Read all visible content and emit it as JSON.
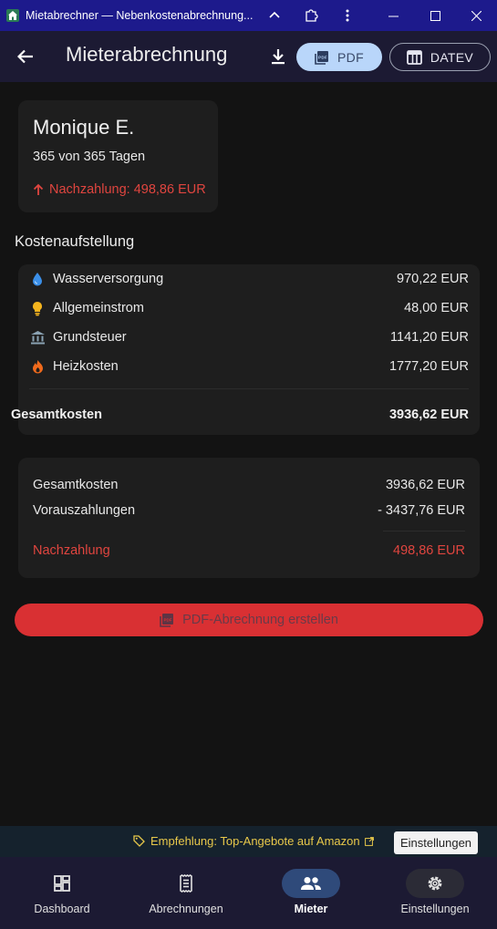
{
  "window": {
    "title": "Mietabrechner — Nebenkostenabrechnung...",
    "icons": [
      "app-home-icon",
      "pin-icon",
      "extension-icon",
      "more-icon",
      "minimize-icon",
      "maximize-icon",
      "close-icon"
    ]
  },
  "appbar": {
    "title": "Mieterabrechnung",
    "pdf_label": "PDF",
    "datev_label": "DATEV"
  },
  "tenant": {
    "name": "Monique E.",
    "days": "365 von 365 Tagen",
    "due": "Nachzahlung: 498,86 EUR"
  },
  "costs": {
    "section_title": "Kostenaufstellung",
    "items": [
      {
        "label": "Wasserversorgung",
        "value": "970,22 EUR",
        "icon": "water-drop-icon",
        "color": "#3b8fe8"
      },
      {
        "label": "Allgemeinstrom",
        "value": "48,00 EUR",
        "icon": "lightbulb-icon",
        "color": "#f5b51e"
      },
      {
        "label": "Grundsteuer",
        "value": "1141,20 EUR",
        "icon": "bank-icon",
        "color": "#8aa2b3"
      },
      {
        "label": "Heizkosten",
        "value": "1777,20 EUR",
        "icon": "flame-icon",
        "color": "#f06a1c"
      }
    ],
    "total_label": "Gesamtkosten",
    "total_value": "3936,62 EUR"
  },
  "summary": {
    "rows": [
      {
        "label": "Gesamtkosten",
        "value": "3936,62 EUR"
      },
      {
        "label": "Vorauszahlungen",
        "value": "- 3437,76 EUR"
      }
    ],
    "result_label": "Nachzahlung",
    "result_value": "498,86 EUR"
  },
  "create_button": "PDF-Abrechnung erstellen",
  "ad": {
    "text": "Empfehlung: Top-Angebote auf Amazon",
    "settings_label": "Einstellungen"
  },
  "nav": {
    "items": [
      {
        "label": "Dashboard",
        "icon": "dashboard-icon"
      },
      {
        "label": "Abrechnungen",
        "icon": "receipt-icon"
      },
      {
        "label": "Mieter",
        "icon": "people-icon",
        "active": true
      },
      {
        "label": "Einstellungen",
        "icon": "gear-icon"
      }
    ]
  },
  "colors": {
    "accent_red": "#e0453f",
    "button_red": "#d93033",
    "pdf_pill": "#b9d6fa",
    "titlebar": "#1d1a8c",
    "nav_active": "#2f4a7a"
  }
}
